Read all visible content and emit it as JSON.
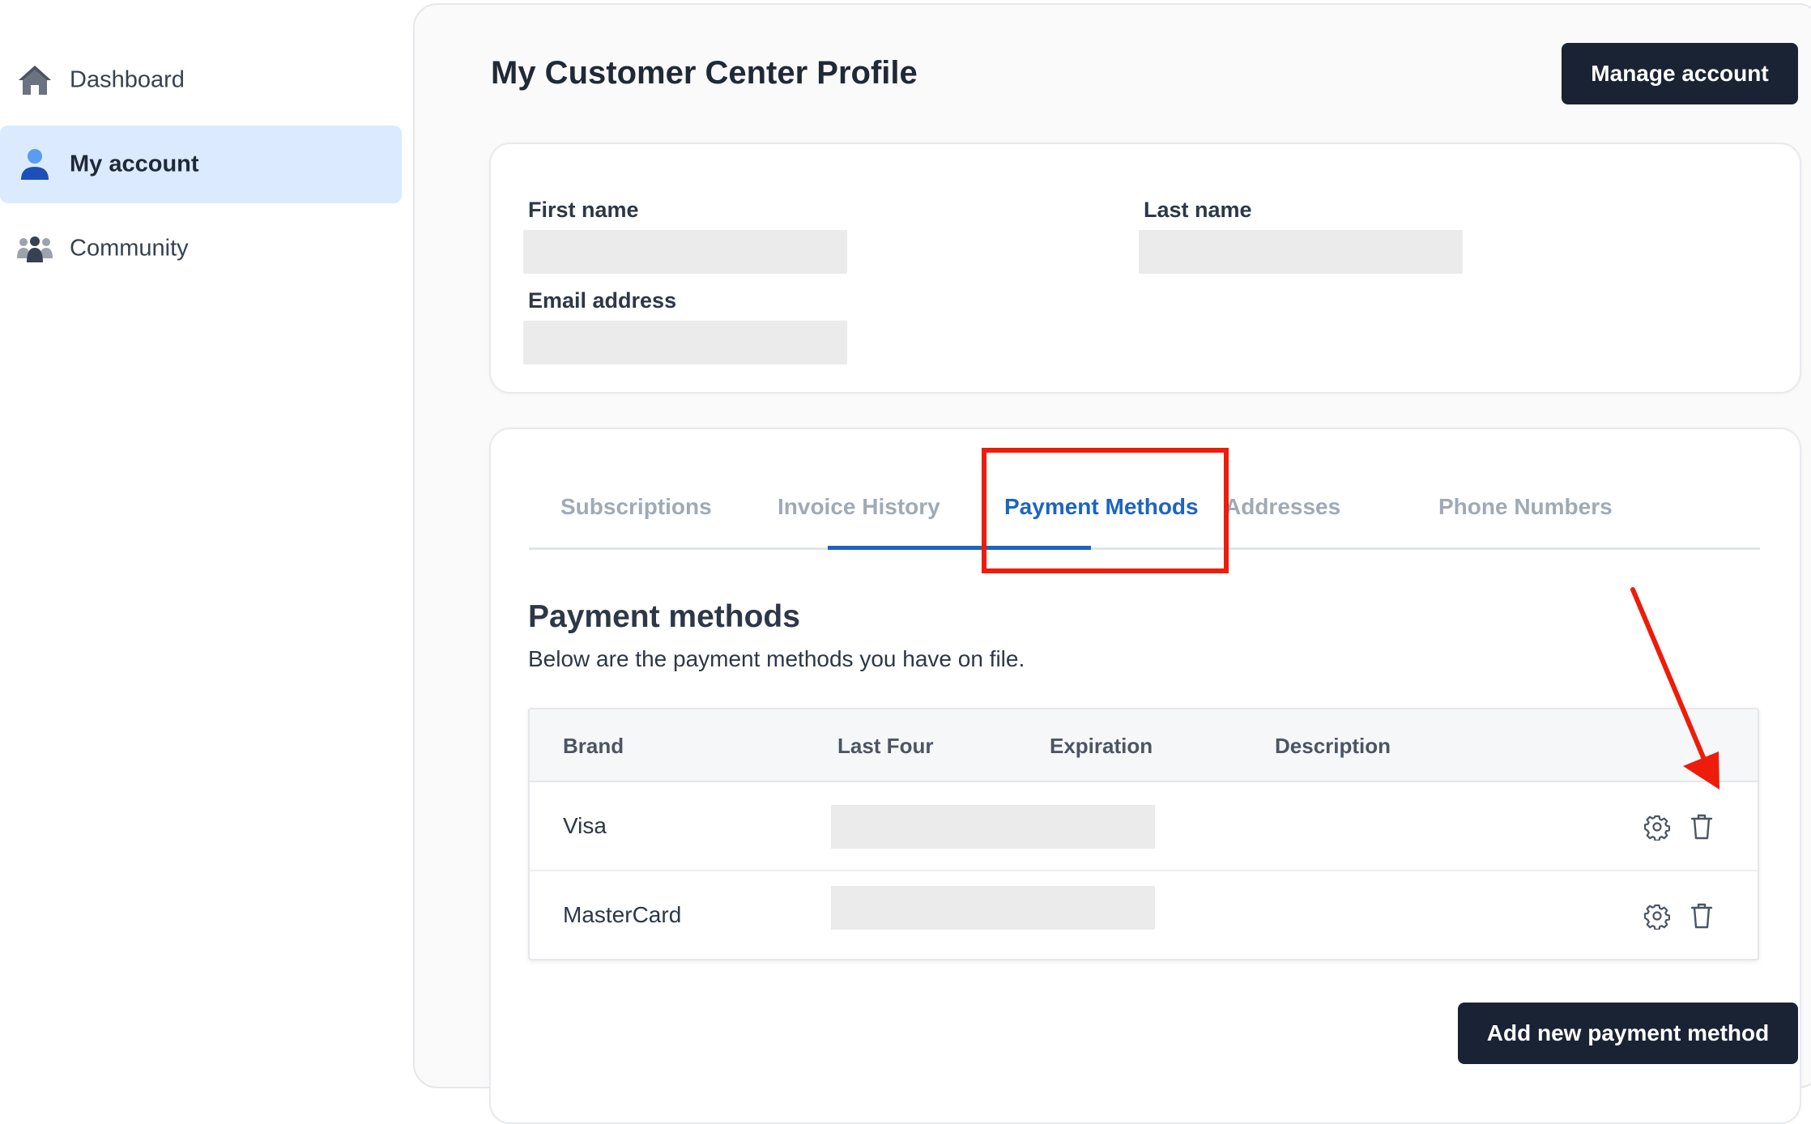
{
  "sidebar": {
    "items": [
      {
        "label": "Dashboard",
        "icon": "home-icon"
      },
      {
        "label": "My account",
        "icon": "user-icon",
        "active": true
      },
      {
        "label": "Community",
        "icon": "community-icon"
      }
    ]
  },
  "header": {
    "title": "My Customer Center Profile",
    "manage_label": "Manage account"
  },
  "profile": {
    "first_name_label": "First name",
    "last_name_label": "Last name",
    "email_label": "Email address"
  },
  "tabs": [
    {
      "label": "Subscriptions"
    },
    {
      "label": "Invoice History"
    },
    {
      "label": "Payment Methods",
      "active": true
    },
    {
      "label": "Addresses"
    },
    {
      "label": "Phone Numbers"
    }
  ],
  "payment": {
    "title": "Payment methods",
    "subtitle": "Below are the payment methods you have on file.",
    "columns": [
      "Brand",
      "Last Four",
      "Expiration",
      "Description"
    ],
    "rows": [
      {
        "brand": "Visa"
      },
      {
        "brand": "MasterCard"
      }
    ],
    "add_label": "Add new payment method"
  },
  "colors": {
    "accent": "#1d64c2",
    "dark_button": "#1a2333",
    "annotation": "#ee1c0a",
    "active_nav_bg": "#dbeafe"
  }
}
